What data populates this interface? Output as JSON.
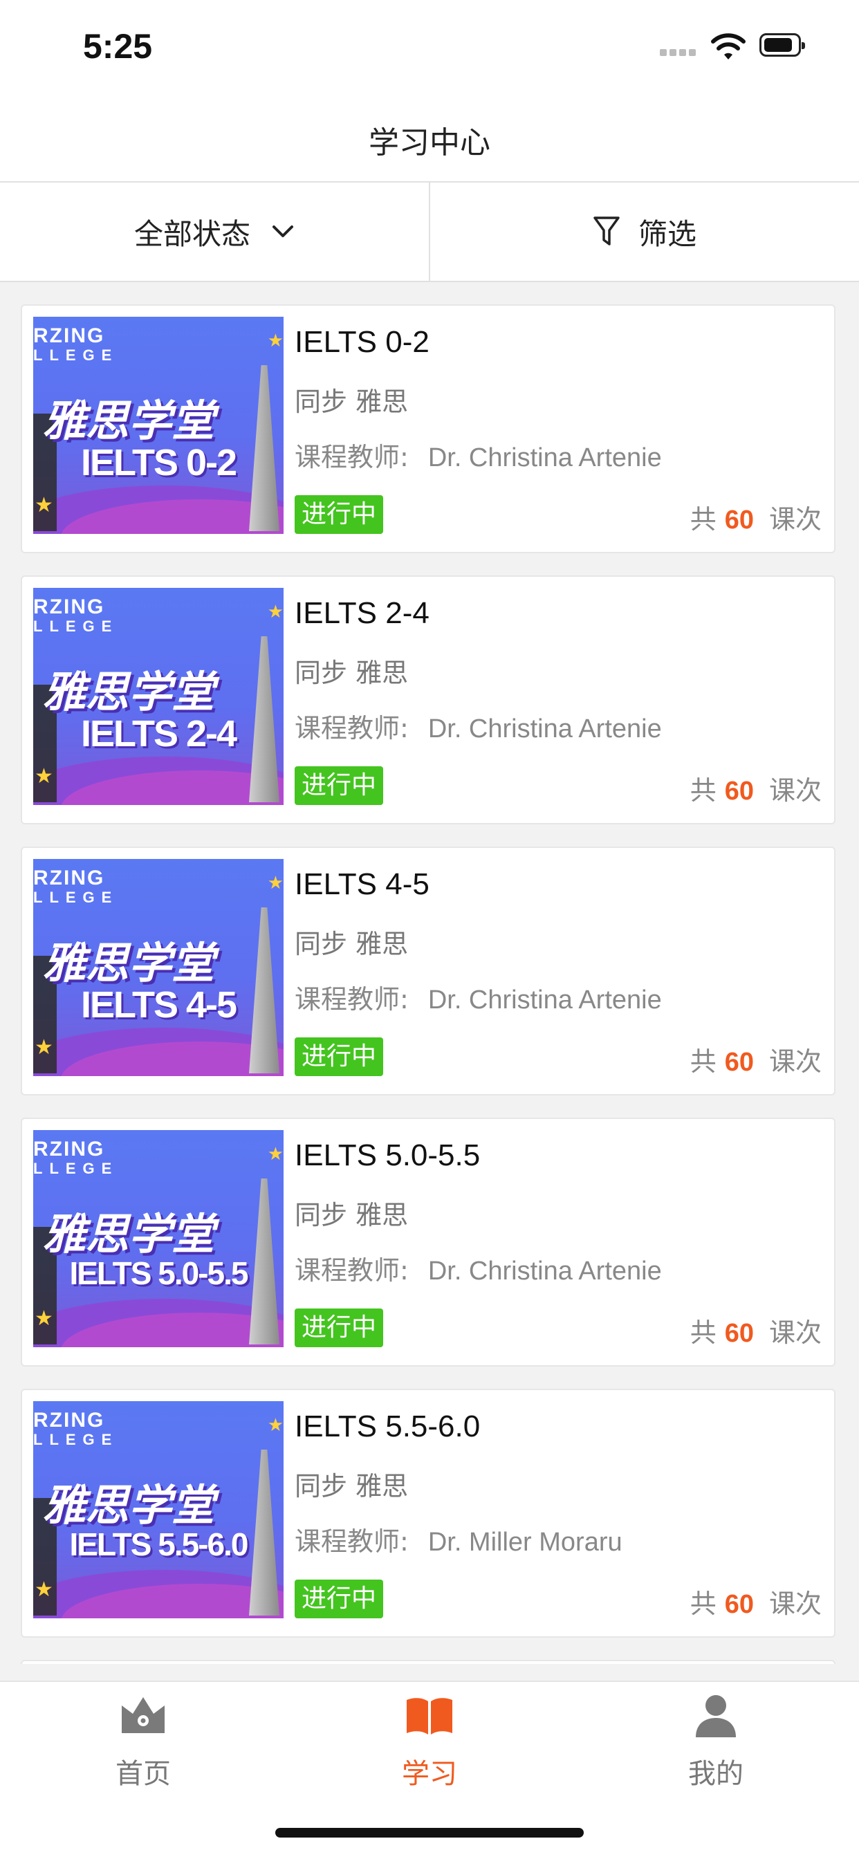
{
  "status_bar": {
    "time": "5:25"
  },
  "nav": {
    "title": "学习中心"
  },
  "filters": {
    "status_label": "全部状态",
    "filter_label": "筛选"
  },
  "courses": [
    {
      "title": "IELTS 0-2",
      "subtitle": "同步 雅思",
      "teacher_label": "课程教师:",
      "teacher": "Dr. Christina Artenie",
      "status": "进行中",
      "count_prefix": "共",
      "count": "60",
      "count_suffix": "课次",
      "thumb_brand": "RZING",
      "thumb_brand2": "LLEGE",
      "thumb_cn": "雅思学堂",
      "thumb_level": "IELTS 0-2"
    },
    {
      "title": "IELTS 2-4",
      "subtitle": "同步 雅思",
      "teacher_label": "课程教师:",
      "teacher": "Dr. Christina Artenie",
      "status": "进行中",
      "count_prefix": "共",
      "count": "60",
      "count_suffix": "课次",
      "thumb_brand": "RZING",
      "thumb_brand2": "LLEGE",
      "thumb_cn": "雅思学堂",
      "thumb_level": "IELTS 2-4"
    },
    {
      "title": "IELTS 4-5",
      "subtitle": "同步 雅思",
      "teacher_label": "课程教师:",
      "teacher": "Dr. Christina Artenie",
      "status": "进行中",
      "count_prefix": "共",
      "count": "60",
      "count_suffix": "课次",
      "thumb_brand": "RZING",
      "thumb_brand2": "LLEGE",
      "thumb_cn": "雅思学堂",
      "thumb_level": "IELTS 4-5"
    },
    {
      "title": "IELTS 5.0-5.5",
      "subtitle": "同步 雅思",
      "teacher_label": "课程教师:",
      "teacher": "Dr. Christina Artenie",
      "status": "进行中",
      "count_prefix": "共",
      "count": "60",
      "count_suffix": "课次",
      "thumb_brand": "RZING",
      "thumb_brand2": "LLEGE",
      "thumb_cn": "雅思学堂",
      "thumb_level": "IELTS 5.0-5.5"
    },
    {
      "title": "IELTS 5.5-6.0",
      "subtitle": "同步 雅思",
      "teacher_label": "课程教师:",
      "teacher": "Dr. Miller Moraru",
      "status": "进行中",
      "count_prefix": "共",
      "count": "60",
      "count_suffix": "课次",
      "thumb_brand": "RZING",
      "thumb_brand2": "LLEGE",
      "thumb_cn": "雅思学堂",
      "thumb_level": "IELTS 5.5-6.0"
    }
  ],
  "tabs": [
    {
      "label": "首页",
      "icon": "crown-home-icon",
      "active": false
    },
    {
      "label": "学习",
      "icon": "open-book-icon",
      "active": true
    },
    {
      "label": "我的",
      "icon": "user-icon",
      "active": false
    }
  ],
  "colors": {
    "accent": "#f05a1f",
    "status_green": "#44c41f",
    "thumb_blue": "#5b79f3"
  }
}
